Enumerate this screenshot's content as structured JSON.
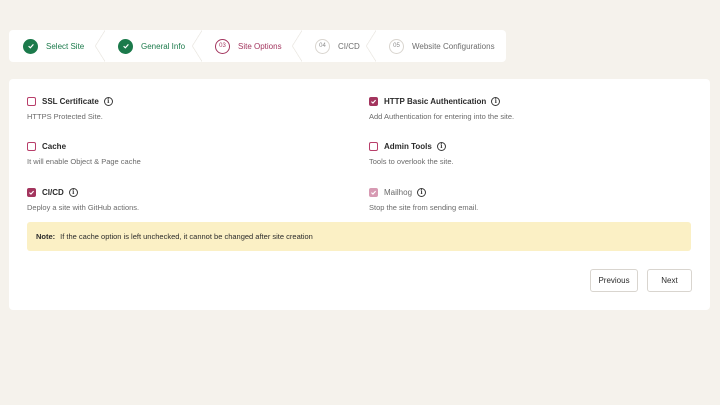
{
  "stepper": {
    "steps": [
      {
        "number": "",
        "label": "Select Site",
        "state": "done"
      },
      {
        "number": "",
        "label": "General Info",
        "state": "done"
      },
      {
        "number": "03",
        "label": "Site Options",
        "state": "active"
      },
      {
        "number": "04",
        "label": "CI/CD",
        "state": "pending"
      },
      {
        "number": "05",
        "label": "Website Configurations",
        "state": "pending"
      }
    ]
  },
  "options": {
    "ssl": {
      "title": "SSL Certificate",
      "desc": "HTTPS Protected Site.",
      "checked": false
    },
    "http_auth": {
      "title": "HTTP Basic Authentication",
      "desc": "Add Authentication for entering into the site.",
      "checked": true
    },
    "cache": {
      "title": "Cache",
      "desc": "It will enable Object & Page cache",
      "checked": false
    },
    "admin_tools": {
      "title": "Admin Tools",
      "desc": "Tools to overlook the site.",
      "checked": false
    },
    "cicd": {
      "title": "CI/CD",
      "desc": "Deploy a site with GitHub actions.",
      "checked": true
    },
    "mailhog": {
      "title": "Mailhog",
      "desc": "Stop the site from sending email.",
      "checked": true,
      "disabled": true
    }
  },
  "note": {
    "label": "Note:",
    "text": "If the cache option is left unchecked, it cannot be changed after site creation"
  },
  "buttons": {
    "previous": "Previous",
    "next": "Next"
  },
  "colors": {
    "accent": "#a3355e",
    "success": "#1b7a4b",
    "note_bg": "#fbf0c5",
    "page_bg": "#f5f2ec"
  }
}
